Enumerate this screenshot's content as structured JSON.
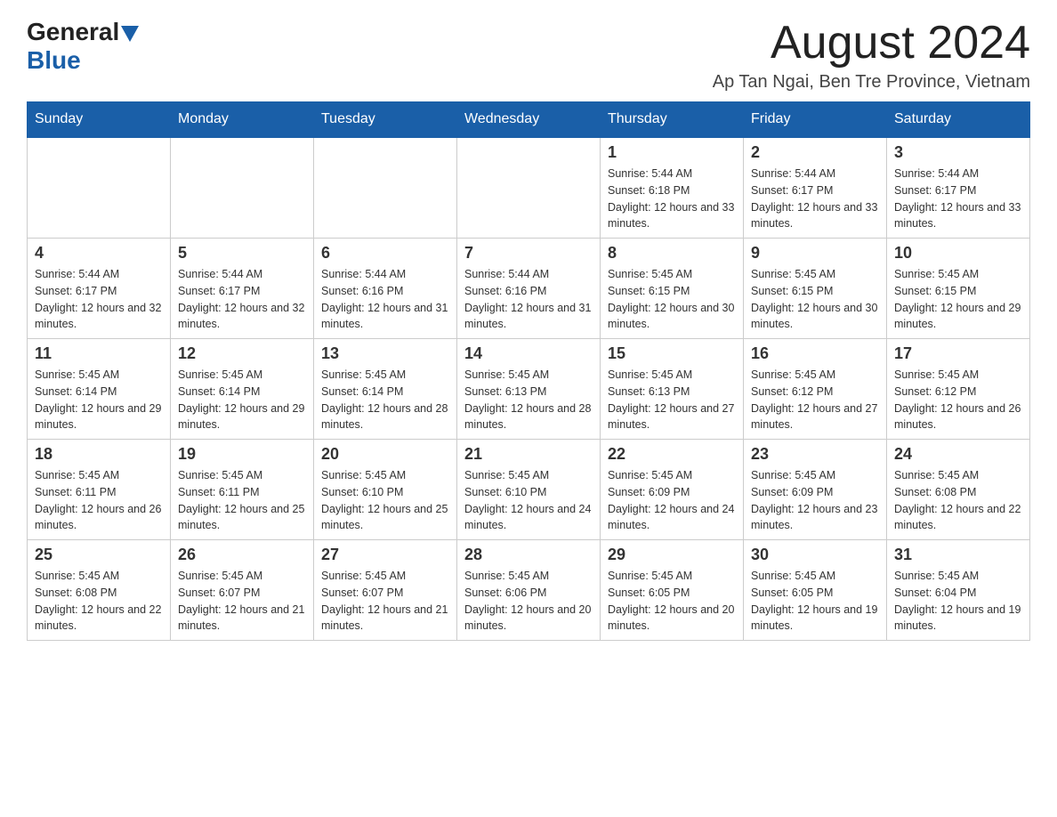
{
  "logo": {
    "general": "General",
    "blue": "Blue"
  },
  "title": {
    "month_year": "August 2024",
    "location": "Ap Tan Ngai, Ben Tre Province, Vietnam"
  },
  "days_of_week": [
    "Sunday",
    "Monday",
    "Tuesday",
    "Wednesday",
    "Thursday",
    "Friday",
    "Saturday"
  ],
  "weeks": [
    [
      {
        "day": "",
        "info": ""
      },
      {
        "day": "",
        "info": ""
      },
      {
        "day": "",
        "info": ""
      },
      {
        "day": "",
        "info": ""
      },
      {
        "day": "1",
        "info": "Sunrise: 5:44 AM\nSunset: 6:18 PM\nDaylight: 12 hours and 33 minutes."
      },
      {
        "day": "2",
        "info": "Sunrise: 5:44 AM\nSunset: 6:17 PM\nDaylight: 12 hours and 33 minutes."
      },
      {
        "day": "3",
        "info": "Sunrise: 5:44 AM\nSunset: 6:17 PM\nDaylight: 12 hours and 33 minutes."
      }
    ],
    [
      {
        "day": "4",
        "info": "Sunrise: 5:44 AM\nSunset: 6:17 PM\nDaylight: 12 hours and 32 minutes."
      },
      {
        "day": "5",
        "info": "Sunrise: 5:44 AM\nSunset: 6:17 PM\nDaylight: 12 hours and 32 minutes."
      },
      {
        "day": "6",
        "info": "Sunrise: 5:44 AM\nSunset: 6:16 PM\nDaylight: 12 hours and 31 minutes."
      },
      {
        "day": "7",
        "info": "Sunrise: 5:44 AM\nSunset: 6:16 PM\nDaylight: 12 hours and 31 minutes."
      },
      {
        "day": "8",
        "info": "Sunrise: 5:45 AM\nSunset: 6:15 PM\nDaylight: 12 hours and 30 minutes."
      },
      {
        "day": "9",
        "info": "Sunrise: 5:45 AM\nSunset: 6:15 PM\nDaylight: 12 hours and 30 minutes."
      },
      {
        "day": "10",
        "info": "Sunrise: 5:45 AM\nSunset: 6:15 PM\nDaylight: 12 hours and 29 minutes."
      }
    ],
    [
      {
        "day": "11",
        "info": "Sunrise: 5:45 AM\nSunset: 6:14 PM\nDaylight: 12 hours and 29 minutes."
      },
      {
        "day": "12",
        "info": "Sunrise: 5:45 AM\nSunset: 6:14 PM\nDaylight: 12 hours and 29 minutes."
      },
      {
        "day": "13",
        "info": "Sunrise: 5:45 AM\nSunset: 6:14 PM\nDaylight: 12 hours and 28 minutes."
      },
      {
        "day": "14",
        "info": "Sunrise: 5:45 AM\nSunset: 6:13 PM\nDaylight: 12 hours and 28 minutes."
      },
      {
        "day": "15",
        "info": "Sunrise: 5:45 AM\nSunset: 6:13 PM\nDaylight: 12 hours and 27 minutes."
      },
      {
        "day": "16",
        "info": "Sunrise: 5:45 AM\nSunset: 6:12 PM\nDaylight: 12 hours and 27 minutes."
      },
      {
        "day": "17",
        "info": "Sunrise: 5:45 AM\nSunset: 6:12 PM\nDaylight: 12 hours and 26 minutes."
      }
    ],
    [
      {
        "day": "18",
        "info": "Sunrise: 5:45 AM\nSunset: 6:11 PM\nDaylight: 12 hours and 26 minutes."
      },
      {
        "day": "19",
        "info": "Sunrise: 5:45 AM\nSunset: 6:11 PM\nDaylight: 12 hours and 25 minutes."
      },
      {
        "day": "20",
        "info": "Sunrise: 5:45 AM\nSunset: 6:10 PM\nDaylight: 12 hours and 25 minutes."
      },
      {
        "day": "21",
        "info": "Sunrise: 5:45 AM\nSunset: 6:10 PM\nDaylight: 12 hours and 24 minutes."
      },
      {
        "day": "22",
        "info": "Sunrise: 5:45 AM\nSunset: 6:09 PM\nDaylight: 12 hours and 24 minutes."
      },
      {
        "day": "23",
        "info": "Sunrise: 5:45 AM\nSunset: 6:09 PM\nDaylight: 12 hours and 23 minutes."
      },
      {
        "day": "24",
        "info": "Sunrise: 5:45 AM\nSunset: 6:08 PM\nDaylight: 12 hours and 22 minutes."
      }
    ],
    [
      {
        "day": "25",
        "info": "Sunrise: 5:45 AM\nSunset: 6:08 PM\nDaylight: 12 hours and 22 minutes."
      },
      {
        "day": "26",
        "info": "Sunrise: 5:45 AM\nSunset: 6:07 PM\nDaylight: 12 hours and 21 minutes."
      },
      {
        "day": "27",
        "info": "Sunrise: 5:45 AM\nSunset: 6:07 PM\nDaylight: 12 hours and 21 minutes."
      },
      {
        "day": "28",
        "info": "Sunrise: 5:45 AM\nSunset: 6:06 PM\nDaylight: 12 hours and 20 minutes."
      },
      {
        "day": "29",
        "info": "Sunrise: 5:45 AM\nSunset: 6:05 PM\nDaylight: 12 hours and 20 minutes."
      },
      {
        "day": "30",
        "info": "Sunrise: 5:45 AM\nSunset: 6:05 PM\nDaylight: 12 hours and 19 minutes."
      },
      {
        "day": "31",
        "info": "Sunrise: 5:45 AM\nSunset: 6:04 PM\nDaylight: 12 hours and 19 minutes."
      }
    ]
  ]
}
